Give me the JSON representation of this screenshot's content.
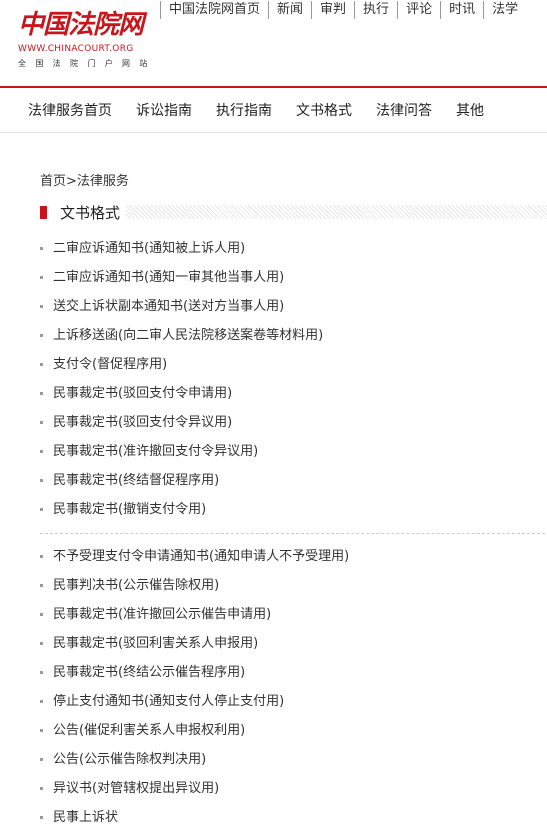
{
  "logo": {
    "main": "中国法院网",
    "url": "WWW.CHINACOURT.ORG",
    "subtitle": "全 国 法 院 门 户 网 站",
    "color": "#c8161d"
  },
  "topnav": [
    "中国法院网首页",
    "新闻",
    "审判",
    "执行",
    "评论",
    "时讯",
    "法学"
  ],
  "secnav": [
    "法律服务首页",
    "诉讼指南",
    "执行指南",
    "文书格式",
    "法律问答",
    "其他"
  ],
  "breadcrumb": {
    "home": "首页",
    "sep": ">",
    "current": "法律服务"
  },
  "section": {
    "title": "文书格式"
  },
  "list_group_1": [
    "二审应诉通知书(通知被上诉人用)",
    "二审应诉通知书(通知一审其他当事人用)",
    "送交上诉状副本通知书(送对方当事人用)",
    "上诉移送函(向二审人民法院移送案卷等材料用)",
    "支付令(督促程序用)",
    "民事裁定书(驳回支付令申请用)",
    "民事裁定书(驳回支付令异议用)",
    "民事裁定书(准许撤回支付令异议用)",
    "民事裁定书(终结督促程序用)",
    "民事裁定书(撤销支付令用)"
  ],
  "list_group_2": [
    "不予受理支付令申请通知书(通知申请人不予受理用)",
    "民事判决书(公示催告除权用)",
    "民事裁定书(准许撤回公示催告申请用)",
    "民事裁定书(驳回利害关系人申报用)",
    "民事裁定书(终结公示催告程序用)",
    "停止支付通知书(通知支付人停止支付用)",
    "公告(催促利害关系人申报权利用)",
    "公告(公示催告除权判决用)",
    "异议书(对管辖权提出异议用)",
    "民事上诉状"
  ]
}
